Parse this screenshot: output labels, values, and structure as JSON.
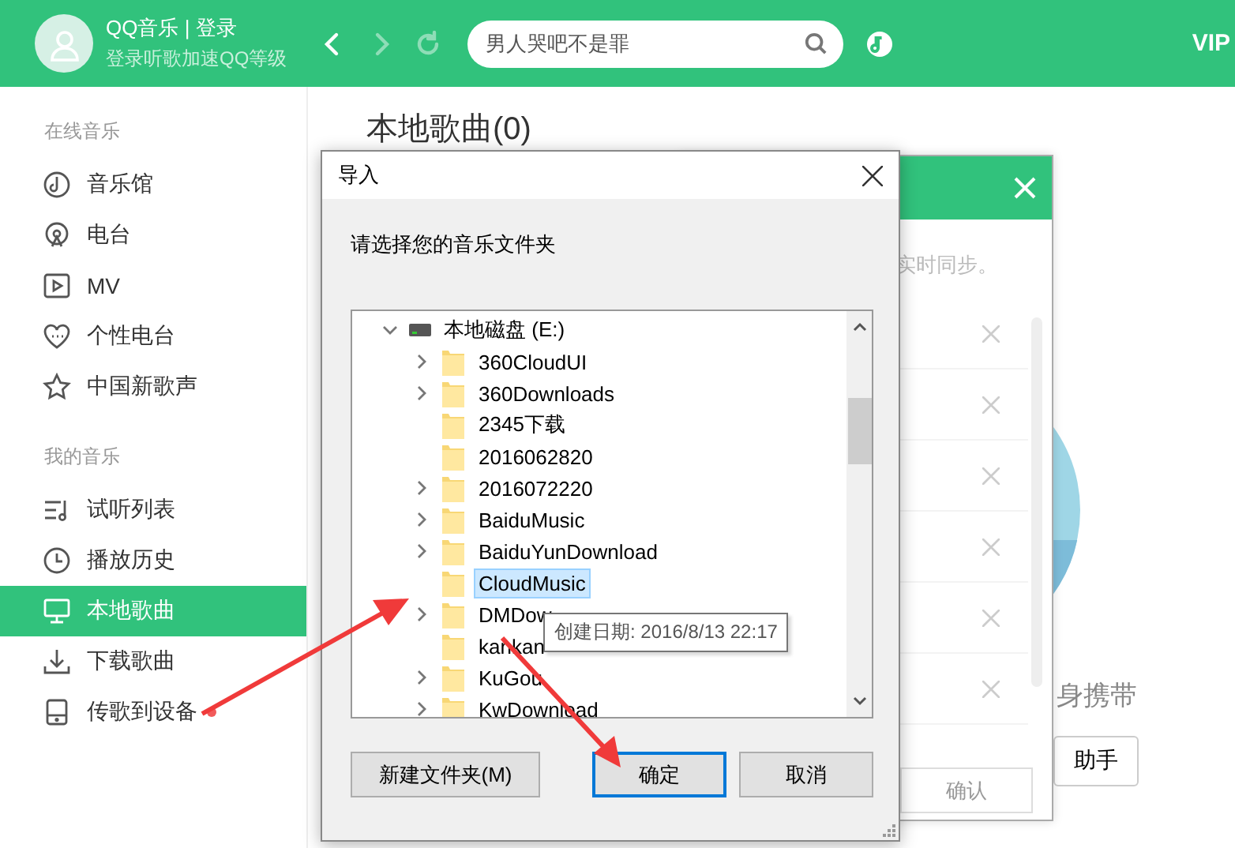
{
  "header": {
    "account": "QQ音乐 | 登录",
    "subtitle": "登录听歌加速QQ等级",
    "nav": [
      {
        "kind": "back",
        "disabled": false
      },
      {
        "kind": "forward",
        "disabled": true
      },
      {
        "kind": "refresh",
        "disabled": true
      }
    ],
    "search": {
      "placeholder": "男人哭吧不是罪"
    },
    "vip": "VIP"
  },
  "sidebar": {
    "sections": [
      {
        "heading": "在线音乐",
        "items": [
          {
            "label": "音乐馆",
            "kind": "disc",
            "selected": false
          },
          {
            "label": "电台",
            "kind": "radio",
            "selected": false
          },
          {
            "label": "MV",
            "kind": "video",
            "selected": false
          },
          {
            "label": "个性电台",
            "kind": "heart",
            "selected": false
          },
          {
            "label": "中国新歌声",
            "kind": "star",
            "selected": false
          }
        ]
      },
      {
        "heading": "我的音乐",
        "items": [
          {
            "label": "试听列表",
            "kind": "list",
            "selected": false
          },
          {
            "label": "播放历史",
            "kind": "clock",
            "selected": false
          },
          {
            "label": "本地歌曲",
            "kind": "monitor",
            "selected": true
          },
          {
            "label": "下载歌曲",
            "kind": "download",
            "selected": false
          },
          {
            "label": "传歌到设备",
            "kind": "device",
            "selected": false,
            "badge": true
          }
        ]
      }
    ]
  },
  "main": {
    "title": "本地歌曲(0)",
    "caption": "身携带",
    "button": "助手"
  },
  "sync_panel": {
    "note": "实时同步。",
    "button": "确认"
  },
  "import_dialog": {
    "title": "导入",
    "prompt": "请选择您的音乐文件夹",
    "tree": {
      "label": "本地磁盘 (E:)",
      "expanded": true,
      "children": [
        {
          "label": "360CloudUI",
          "expandable": true,
          "selected": false
        },
        {
          "label": "360Downloads",
          "expandable": true,
          "selected": false
        },
        {
          "label": "2345下载",
          "expandable": false,
          "selected": false
        },
        {
          "label": "2016062820",
          "expandable": false,
          "selected": false
        },
        {
          "label": "2016072220",
          "expandable": true,
          "selected": false
        },
        {
          "label": "BaiduMusic",
          "expandable": true,
          "selected": false
        },
        {
          "label": "BaiduYunDownload",
          "expandable": true,
          "selected": false
        },
        {
          "label": "CloudMusic",
          "expandable": false,
          "selected": true
        },
        {
          "label": "DMDow",
          "expandable": true,
          "selected": false
        },
        {
          "label": "kankan",
          "expandable": false,
          "selected": false
        },
        {
          "label": "KuGou",
          "expandable": true,
          "selected": false
        },
        {
          "label": "KwDownload",
          "expandable": true,
          "selected": false
        }
      ]
    },
    "tooltip": "创建日期: 2016/8/13 22:17",
    "buttons": [
      {
        "label": "新建文件夹(M)",
        "kind": "new",
        "focused": false
      },
      {
        "label": "确定",
        "kind": "ok",
        "focused": true
      },
      {
        "label": "取消",
        "kind": "cancel",
        "focused": false
      }
    ]
  }
}
